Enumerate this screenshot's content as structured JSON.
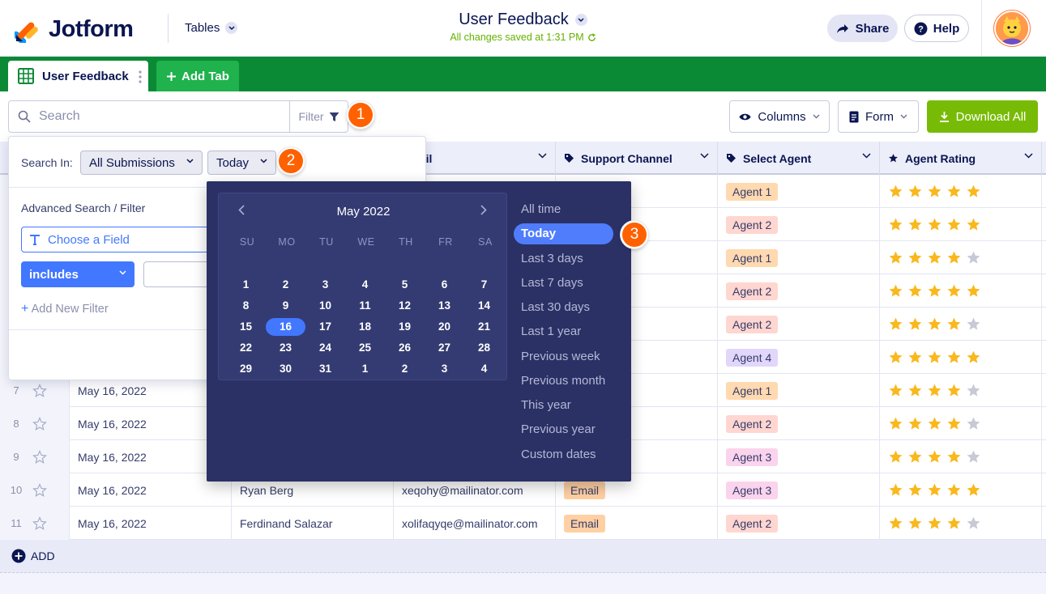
{
  "header": {
    "brand": "Jotform",
    "tables_label": "Tables",
    "title": "User Feedback",
    "saved_status": "All changes saved at 1:31 PM",
    "share_label": "Share",
    "help_label": "Help"
  },
  "tabs": {
    "active_label": "User Feedback",
    "add_tab_label": "Add Tab"
  },
  "toolbar": {
    "search_placeholder": "Search",
    "filter_label": "Filter",
    "columns_label": "Columns",
    "form_label": "Form",
    "download_label": "Download All"
  },
  "badges": [
    "1",
    "2",
    "3"
  ],
  "columns": [
    {
      "label": "Email",
      "icon": "email-icon"
    },
    {
      "label": "Support Channel",
      "icon": "tag-icon"
    },
    {
      "label": "Select Agent",
      "icon": "tag-icon"
    },
    {
      "label": "Agent Rating",
      "icon": "star-icon"
    }
  ],
  "rows": [
    {
      "num": "",
      "date": "",
      "name": "",
      "email": "",
      "channel": "",
      "agent": "Agent 1",
      "rating": 5
    },
    {
      "num": "",
      "date": "",
      "name": "",
      "email": "",
      "channel": "",
      "agent": "Agent 2",
      "rating": 5
    },
    {
      "num": "",
      "date": "",
      "name": "",
      "email": "",
      "channel": "",
      "agent": "Agent 1",
      "rating": 4
    },
    {
      "num": "",
      "date": "",
      "name": "",
      "email": "",
      "channel": "",
      "agent": "Agent 2",
      "rating": 5
    },
    {
      "num": "",
      "date": "",
      "name": "",
      "email": "",
      "channel": "",
      "agent": "Agent 2",
      "rating": 4
    },
    {
      "num": "",
      "date": "",
      "name": "",
      "email": "",
      "channel": "",
      "agent": "Agent 4",
      "rating": 5
    },
    {
      "num": "7",
      "date": "May 16, 2022",
      "name": "",
      "email": "",
      "channel": "",
      "agent": "Agent 1",
      "rating": 4
    },
    {
      "num": "8",
      "date": "May 16, 2022",
      "name": "",
      "email": "",
      "channel": "",
      "agent": "Agent 2",
      "rating": 4
    },
    {
      "num": "9",
      "date": "May 16, 2022",
      "name": "",
      "email": "",
      "channel": "",
      "agent": "Agent 3",
      "rating": 4
    },
    {
      "num": "10",
      "date": "May 16, 2022",
      "name": "Ryan Berg",
      "email": "xeqohy@mailinator.com",
      "channel": "Email",
      "agent": "Agent 3",
      "rating": 5
    },
    {
      "num": "11",
      "date": "May 16, 2022",
      "name": "Ferdinand Salazar",
      "email": "xolifaqyqe@mailinator.com",
      "channel": "Email",
      "agent": "Agent 2",
      "rating": 4
    }
  ],
  "add_row_label": "ADD",
  "filter_popup": {
    "search_in_label": "Search In:",
    "scope_value": "All Submissions",
    "date_value": "Today",
    "advanced_label": "Advanced Search / Filter",
    "field_placeholder": "Choose a Field",
    "operator_value": "includes",
    "add_filter_label": "Add New Filter"
  },
  "calendar": {
    "month_label": "May 2022",
    "weekdays": [
      "SU",
      "MO",
      "TU",
      "WE",
      "TH",
      "FR",
      "SA"
    ],
    "weeks": [
      [
        "1",
        "2",
        "3",
        "4",
        "5",
        "6",
        "7"
      ],
      [
        "8",
        "9",
        "10",
        "11",
        "12",
        "13",
        "14"
      ],
      [
        "15",
        "16",
        "17",
        "18",
        "19",
        "20",
        "21"
      ],
      [
        "22",
        "23",
        "24",
        "25",
        "26",
        "27",
        "28"
      ],
      [
        "29",
        "30",
        "31",
        "1",
        "2",
        "3",
        "4"
      ]
    ],
    "selected_day": "16"
  },
  "ranges": [
    "All time",
    "Today",
    "Last 3 days",
    "Last 7 days",
    "Last 30 days",
    "Last 1 year",
    "Previous week",
    "Previous month",
    "This year",
    "Previous year",
    "Custom dates"
  ],
  "active_range": "Today",
  "colors": {
    "brand_green": "#0b8a35",
    "accent_blue": "#4277ff",
    "badge_orange": "#ff6100",
    "star_yellow": "#f9b81d",
    "download_green": "#78bb07"
  }
}
